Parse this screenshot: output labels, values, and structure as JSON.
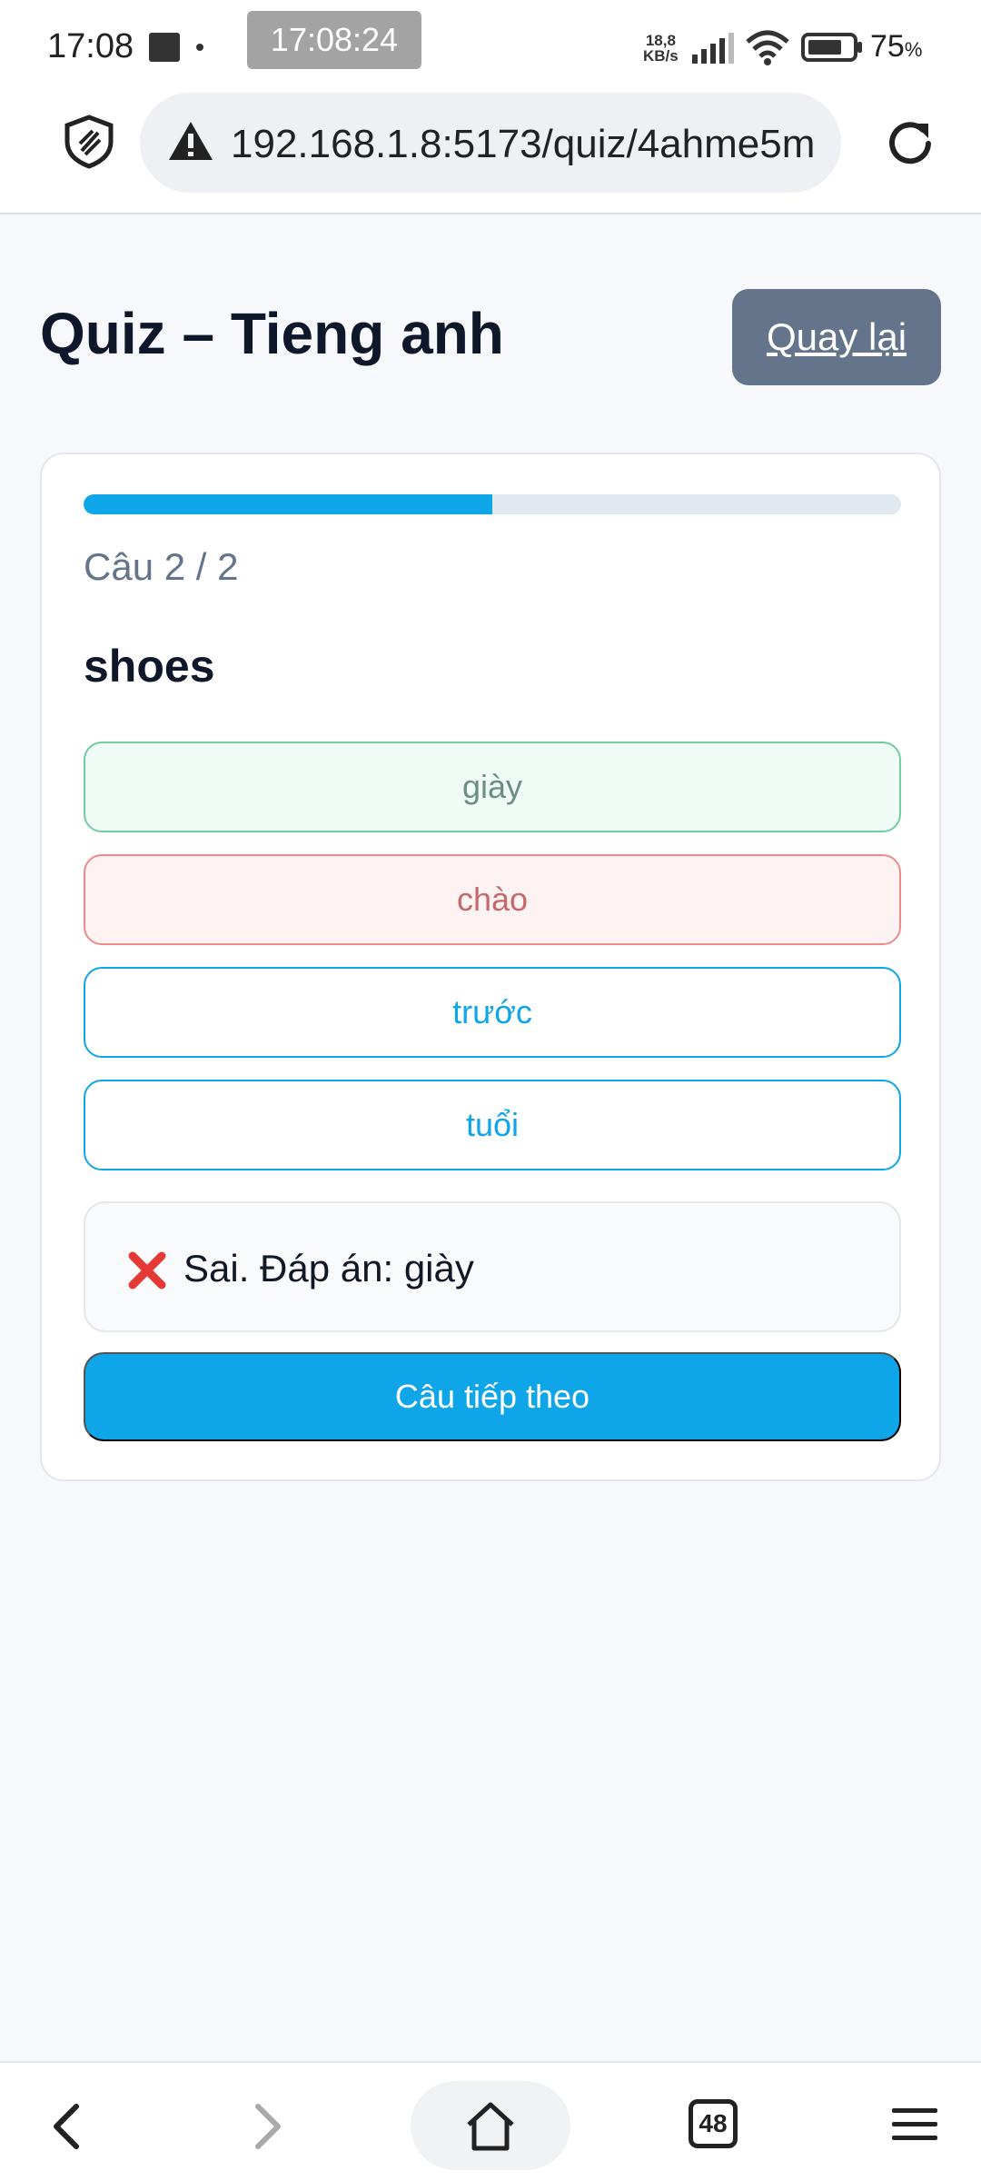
{
  "status_bar": {
    "time": "17:08",
    "overlay_time": "17:08:24",
    "network_speed_value": "18,8",
    "network_speed_unit": "KB/s",
    "battery_percent": "75",
    "battery_unit": "%"
  },
  "browser": {
    "url": "192.168.1.8:5173/quiz/4ahme5m",
    "tab_count": "48"
  },
  "page": {
    "title": "Quiz – Tieng anh",
    "back_label": "Quay lại"
  },
  "quiz": {
    "progress_fraction": 0.5,
    "counter": "Câu 2 / 2",
    "question": "shoes",
    "options": [
      {
        "label": "giày",
        "state": "correct"
      },
      {
        "label": "chào",
        "state": "wrong"
      },
      {
        "label": "trước",
        "state": "default"
      },
      {
        "label": "tuổi",
        "state": "default"
      }
    ],
    "feedback": "Sai. Đáp án: giày",
    "next_label": "Câu tiếp theo"
  },
  "colors": {
    "accent": "#0ea5e9",
    "back_button": "#64748b",
    "correct_border": "#6fcf9f",
    "wrong_border": "#f08a8a"
  },
  "icons": [
    "shield-icon",
    "warning-icon",
    "reload-icon",
    "x-mark-icon",
    "back-arrow-icon",
    "forward-arrow-icon",
    "home-icon",
    "menu-icon"
  ]
}
